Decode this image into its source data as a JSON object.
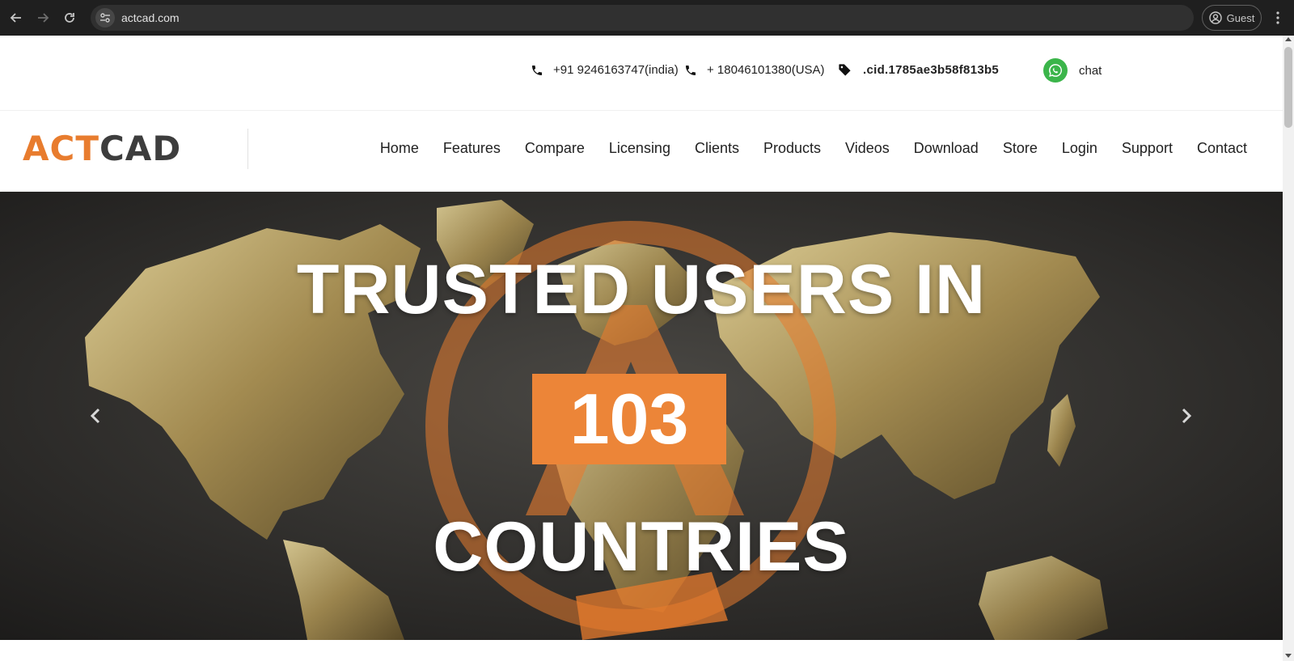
{
  "browser": {
    "url": "actcad.com",
    "profile_label": "Guest"
  },
  "topbar": {
    "phone_india": "+91 9246163747(india)",
    "phone_usa": "+ 18046101380(USA)",
    "cid": ".cid.1785ae3b58f813b5",
    "chat_label": "chat"
  },
  "header": {
    "logo_act": "ACT",
    "logo_cad": "CAD",
    "nav": [
      "Home",
      "Features",
      "Compare",
      "Licensing",
      "Clients",
      "Products",
      "Videos",
      "Download",
      "Store",
      "Login",
      "Support",
      "Contact"
    ]
  },
  "hero": {
    "line1": "TRUSTED USERS IN",
    "count": "103",
    "line3": "COUNTRIES"
  },
  "colors": {
    "accent_orange": "#ec8538",
    "logo_dark": "#3d3d3d",
    "whatsapp_green": "#3bb54a",
    "chrome_bg": "#1f1f1f"
  },
  "icons": [
    "back-arrow-icon",
    "forward-arrow-icon",
    "reload-icon",
    "site-info-icon",
    "profile-icon",
    "menu-dots-icon",
    "phone-icon",
    "tag-icon",
    "whatsapp-icon",
    "chevron-left-icon",
    "chevron-right-icon"
  ]
}
